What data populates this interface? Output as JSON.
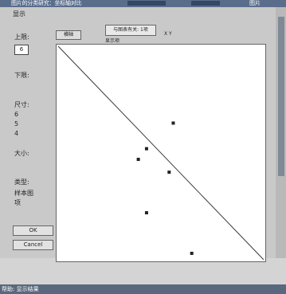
{
  "titlebar": {
    "title": "图片的分类研究：坐标轴对比",
    "right_text": "图片"
  },
  "window": {
    "title": "显示"
  },
  "sidebar": {
    "label_upper": "上限:",
    "upper_value": "6",
    "label_lower": "下限:",
    "label_size": "尺寸:",
    "size_a": "6",
    "size_b": "5",
    "size_c": "4",
    "label_scale": "大小:",
    "label_type": "类型:",
    "label_type_value1": "样本图",
    "label_type_value2": "项",
    "ok_label": "OK",
    "cancel_label": "Cancel"
  },
  "toolbar": {
    "left_box": "横轴",
    "dropdown_label": "与图表有关: 1项",
    "radio_text": "显示项",
    "coords_text": "X  Y"
  },
  "statusbar": {
    "text": "帮助: 显示结果"
  },
  "chart_data": {
    "type": "scatter",
    "series": [
      {
        "x": [
          0.56,
          0.43,
          0.39,
          0.54,
          0.43,
          0.65
        ],
        "y": [
          0.64,
          0.52,
          0.47,
          0.41,
          0.22,
          0.03
        ]
      }
    ],
    "reference_line": {
      "from": [
        0,
        1
      ],
      "to": [
        1,
        0
      ]
    },
    "xlim": [
      0,
      1
    ],
    "ylim": [
      0,
      1
    ]
  }
}
